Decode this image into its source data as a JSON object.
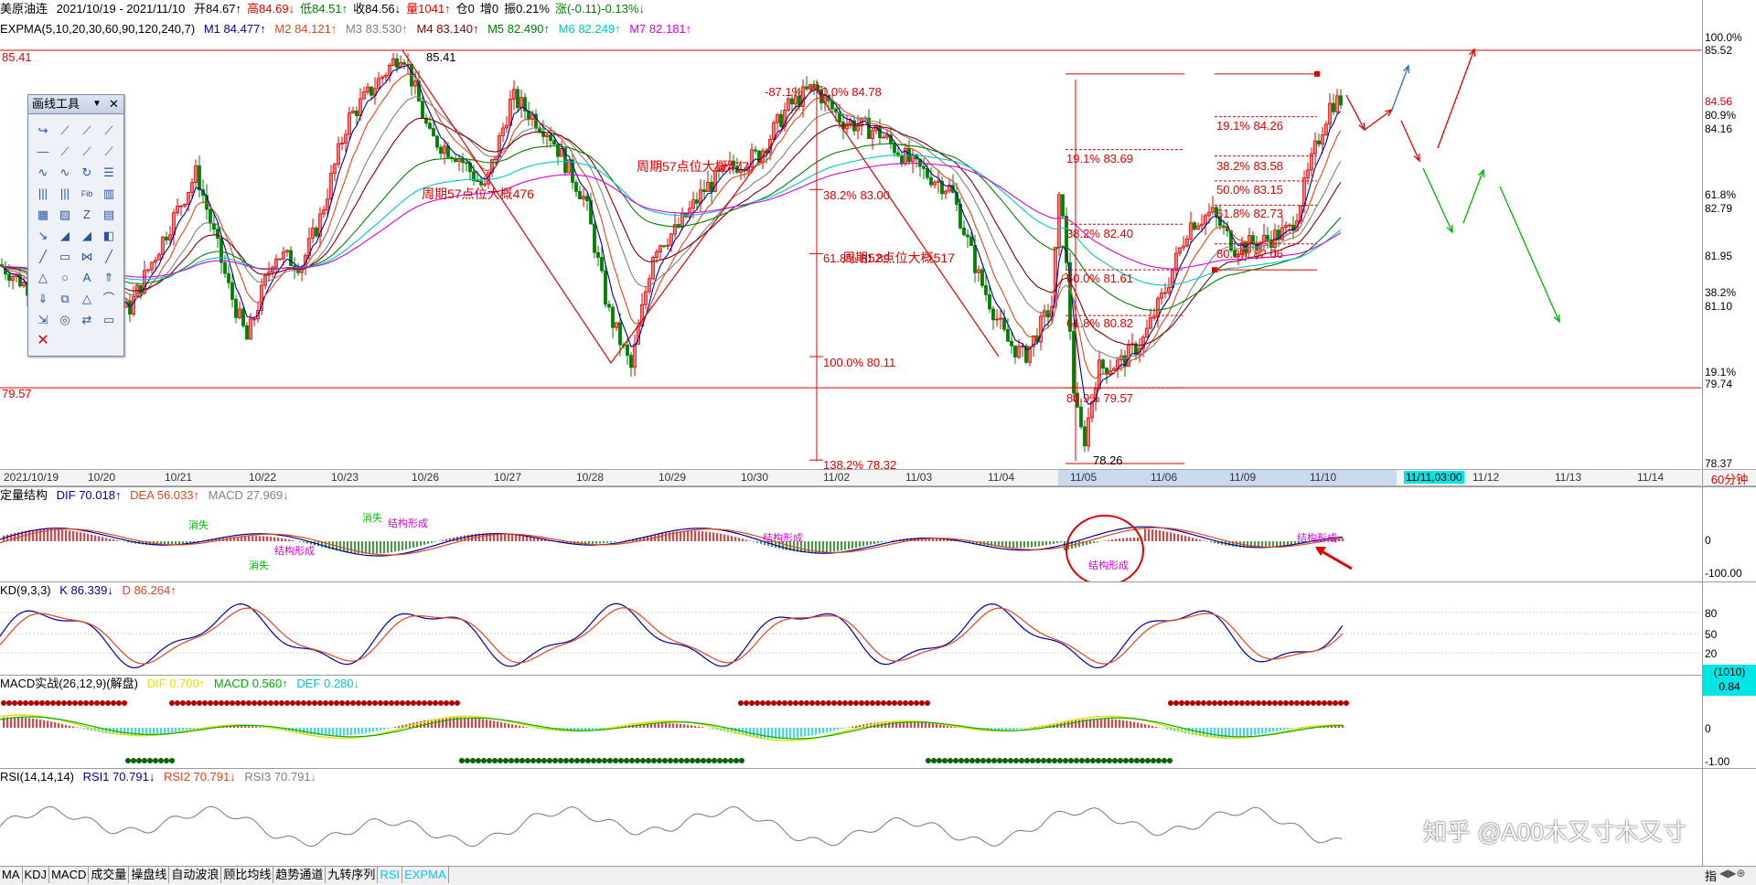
{
  "header": {
    "name": "美原油连",
    "range": "2021/10/19 - 2021/11/10",
    "open": "开84.67↑",
    "high": "高84.69↓",
    "low": "低84.51↑",
    "close": "收84.56↓",
    "volume": "量1041↑",
    "position": "仓0",
    "increase": "增0",
    "amplitude": "振0.21%",
    "change": "涨(-0.11)-0.13%↓"
  },
  "expma": {
    "label": "EXPMA(5,10,20,30,60,90,120,240,7)",
    "m1": "M1 84.477↑",
    "m2": "M2 84.121↑",
    "m3": "M3 83.530↑",
    "m4": "M4 83.140↑",
    "m5": "M5 82.490↑",
    "m6": "M6 82.249↑",
    "m7": "M7 82.181↑"
  },
  "colors": {
    "m1": "#0000a0",
    "m2": "#e0461e",
    "m3": "#808080",
    "m4": "#800000",
    "m5": "#008000",
    "m6": "#00c8c8",
    "m7": "#e000e0",
    "up": "#e00000",
    "down": "#008000",
    "fib": "#e00000",
    "green_arrow": "#00b000",
    "blue_arrow": "#2a6ad0"
  },
  "main_chart": {
    "level_high": "85.41",
    "level_low": "79.57",
    "peak_label": "85.41",
    "trough_label": "78.26",
    "cycle_labels": [
      "周期57点位大概476",
      "周期57点位大概477",
      "周期52点位大概517"
    ],
    "fib_left": [
      "-87.1%",
      "0.0% 84.78",
      "38.2% 83.00",
      "61.8% 81.89",
      "100.0% 80.11",
      "138.2% 78.32"
    ],
    "fib_mid": [
      "19.1% 83.69",
      "38.2% 82.40",
      "50.0% 81.61",
      "61.8% 80.82",
      "80.9% 79.57"
    ],
    "fib_right": [
      "19.1% 84.26",
      "38.2% 83.58",
      "50.0% 83.15",
      "61.8% 82.73",
      "80.9% 82.06"
    ]
  },
  "right_axis": {
    "ticks": [
      {
        "label": "100.0%",
        "color": "#000"
      },
      {
        "label": "85.52",
        "color": "#000"
      },
      {
        "label": "84.56",
        "color": "#e00000"
      },
      {
        "label": "80.9%",
        "color": "#000"
      },
      {
        "label": "84.16",
        "color": "#000"
      },
      {
        "label": "61.8%",
        "color": "#000"
      },
      {
        "label": "82.79",
        "color": "#000"
      },
      {
        "label": "81.95",
        "color": "#000"
      },
      {
        "label": "38.2%",
        "color": "#000"
      },
      {
        "label": "81.10",
        "color": "#000"
      },
      {
        "label": "19.1%",
        "color": "#000"
      },
      {
        "label": "79.74",
        "color": "#000"
      },
      {
        "label": "78.37",
        "color": "#000"
      }
    ]
  },
  "dates": {
    "labels": [
      "2021/10/19",
      "10/20",
      "10/21",
      "10/22",
      "10/23",
      "10/26",
      "10/27",
      "10/28",
      "10/29",
      "10/30",
      "11/02",
      "11/03",
      "11/04",
      "11/05",
      "11/06",
      "11/09",
      "11/10",
      "11/11,03:00",
      "11/12",
      "11/13",
      "11/14"
    ],
    "period": "60分钟"
  },
  "struct_panel": {
    "title": "定量结构",
    "dif": "DIF 70.018↑",
    "dea": "DEA 56.033↑",
    "macd": "MACD 27.969↓",
    "axis": [
      "0",
      "-100.00"
    ],
    "labels": [
      "消失",
      "消失",
      "结构形成",
      "消失",
      "结构形成",
      "结构形成",
      "结构形成",
      "结构形成"
    ]
  },
  "kd_panel": {
    "title": "KD(9,3,3)",
    "k": "K 86.339↓",
    "d": "D 86.264↑",
    "axis": [
      "80",
      "50",
      "20"
    ]
  },
  "macd_panel": {
    "title": "MACD实战(26,12,9)(解盘)",
    "dif": "DIF 0.700↑",
    "macd": "MACD 0.560↑",
    "def": "DEF 0.280↓",
    "axis": [
      "(1010)",
      "0.84",
      "0",
      "-1.00"
    ]
  },
  "rsi_panel": {
    "title": "RSI(14,14,14)",
    "rsi1": "RSI1 70.791↓",
    "rsi2": "RSI2 70.791↓",
    "rsi3": "RSI3 70.791↓"
  },
  "toolbox": {
    "title": "画线工具",
    "icons": [
      "↪",
      "⟋",
      "⟋",
      "⟋",
      "—",
      "⟋",
      "⟋",
      "⟋",
      "∿",
      "∿",
      "↻",
      "☰",
      "|||",
      "|||",
      "Fib",
      "▥",
      "▦",
      "▨",
      "Z",
      "▤",
      "↘",
      "◢",
      "◢",
      "◧",
      "╱",
      "▭",
      "⋈",
      "╱",
      "△",
      "○",
      "A",
      "⇑",
      "⇓",
      "⧉",
      "△",
      "⌒",
      "⇲",
      "◎",
      "⇄",
      "▭",
      "✕"
    ]
  },
  "tabs": [
    "MA",
    "KDJ",
    "MACD",
    "成交量",
    "操盘线",
    "自动波浪",
    "顾比均线",
    "趋势通道",
    "九转序列",
    "RSI",
    "EXPMA"
  ],
  "tab_colors": {
    "RSI": "#00c8ff",
    "EXPMA": "#00c8ff"
  },
  "status_right": "指",
  "watermark": "知乎 @A00木又寸木又寸"
}
